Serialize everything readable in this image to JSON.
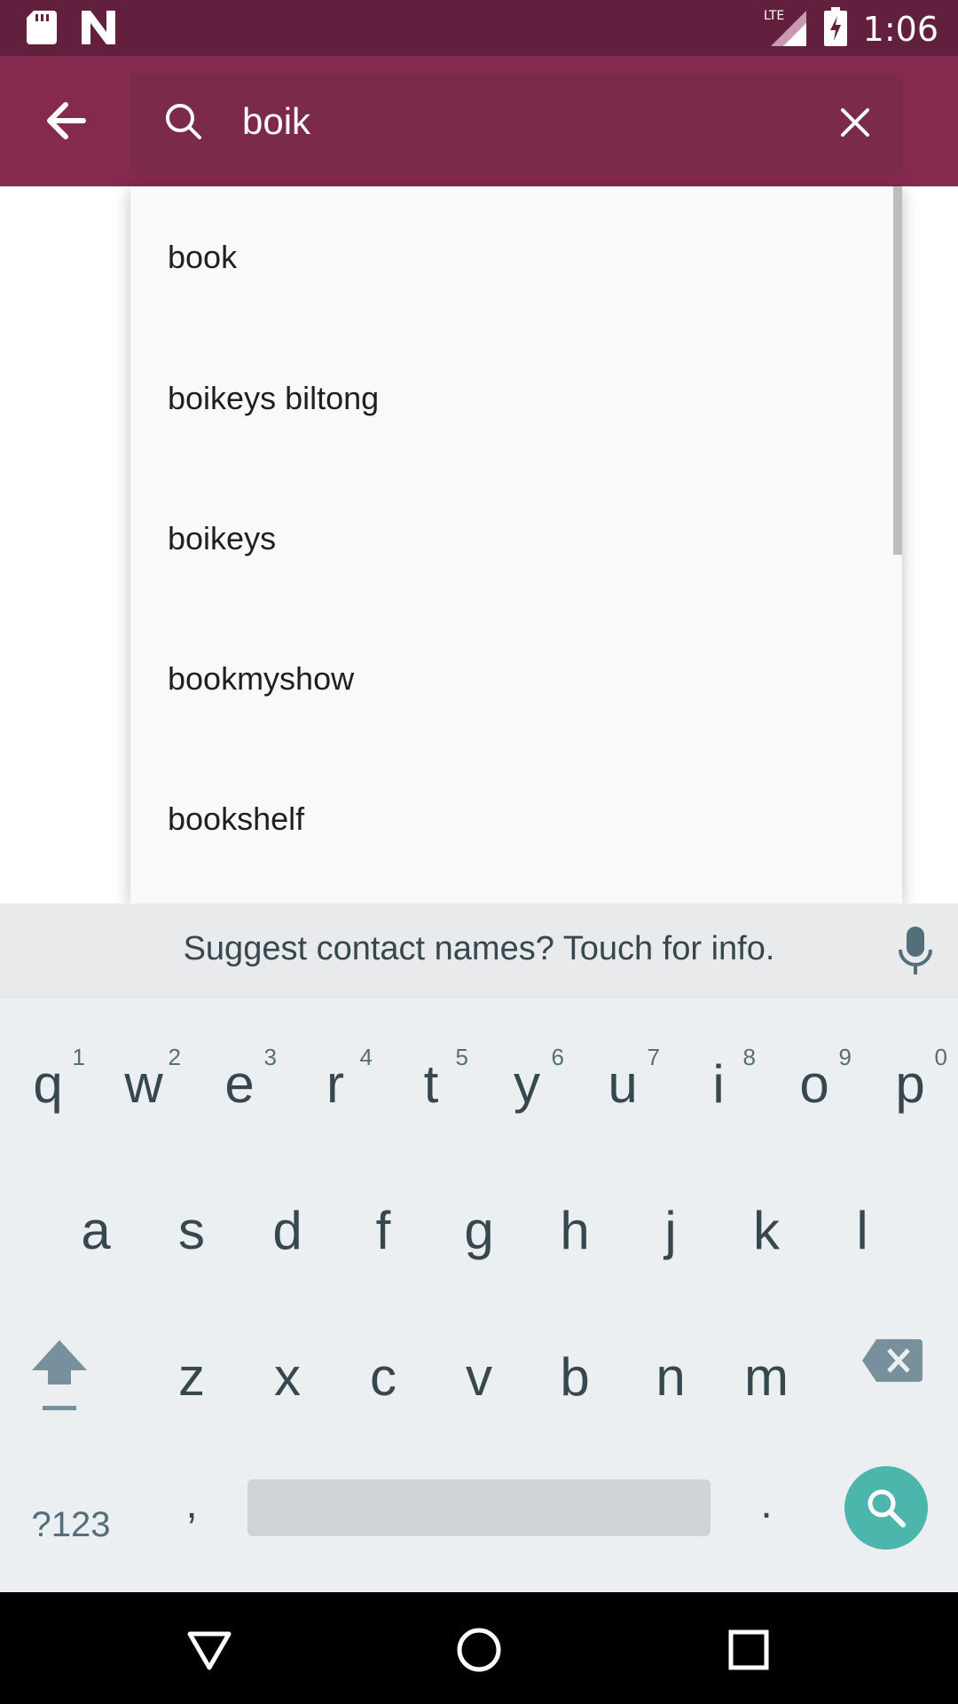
{
  "status_bar": {
    "time": "1:06",
    "network": "LTE",
    "icons": [
      "sd-card-icon",
      "n-notification-icon",
      "lte-signal-icon",
      "battery-charging-icon"
    ]
  },
  "search": {
    "query": "boik",
    "icons": {
      "back": "arrow-left-icon",
      "search": "search-icon",
      "clear": "close-icon"
    }
  },
  "suggestions": [
    "book",
    "boikeys biltong",
    "boikeys",
    "bookmyshow",
    "bookshelf"
  ],
  "keyboard": {
    "suggest_strip": "Suggest contact names? Touch for info.",
    "row1": [
      {
        "key": "q",
        "hint": "1"
      },
      {
        "key": "w",
        "hint": "2"
      },
      {
        "key": "e",
        "hint": "3"
      },
      {
        "key": "r",
        "hint": "4"
      },
      {
        "key": "t",
        "hint": "5"
      },
      {
        "key": "y",
        "hint": "6"
      },
      {
        "key": "u",
        "hint": "7"
      },
      {
        "key": "i",
        "hint": "8"
      },
      {
        "key": "o",
        "hint": "9"
      },
      {
        "key": "p",
        "hint": "0"
      }
    ],
    "row2": [
      "a",
      "s",
      "d",
      "f",
      "g",
      "h",
      "j",
      "k",
      "l"
    ],
    "row3": [
      "z",
      "x",
      "c",
      "v",
      "b",
      "n",
      "m"
    ],
    "symbols_label": "?123",
    "comma": ",",
    "period": ".",
    "colors": {
      "accent": "#4db6ac",
      "key_text": "#37474f"
    }
  },
  "colors": {
    "status_bar": "#631f3e",
    "app_bar": "#86294f",
    "search_box": "#7b2a4b"
  },
  "nav": {
    "icons": [
      "back-triangle-icon",
      "home-circle-icon",
      "recents-square-icon"
    ]
  }
}
